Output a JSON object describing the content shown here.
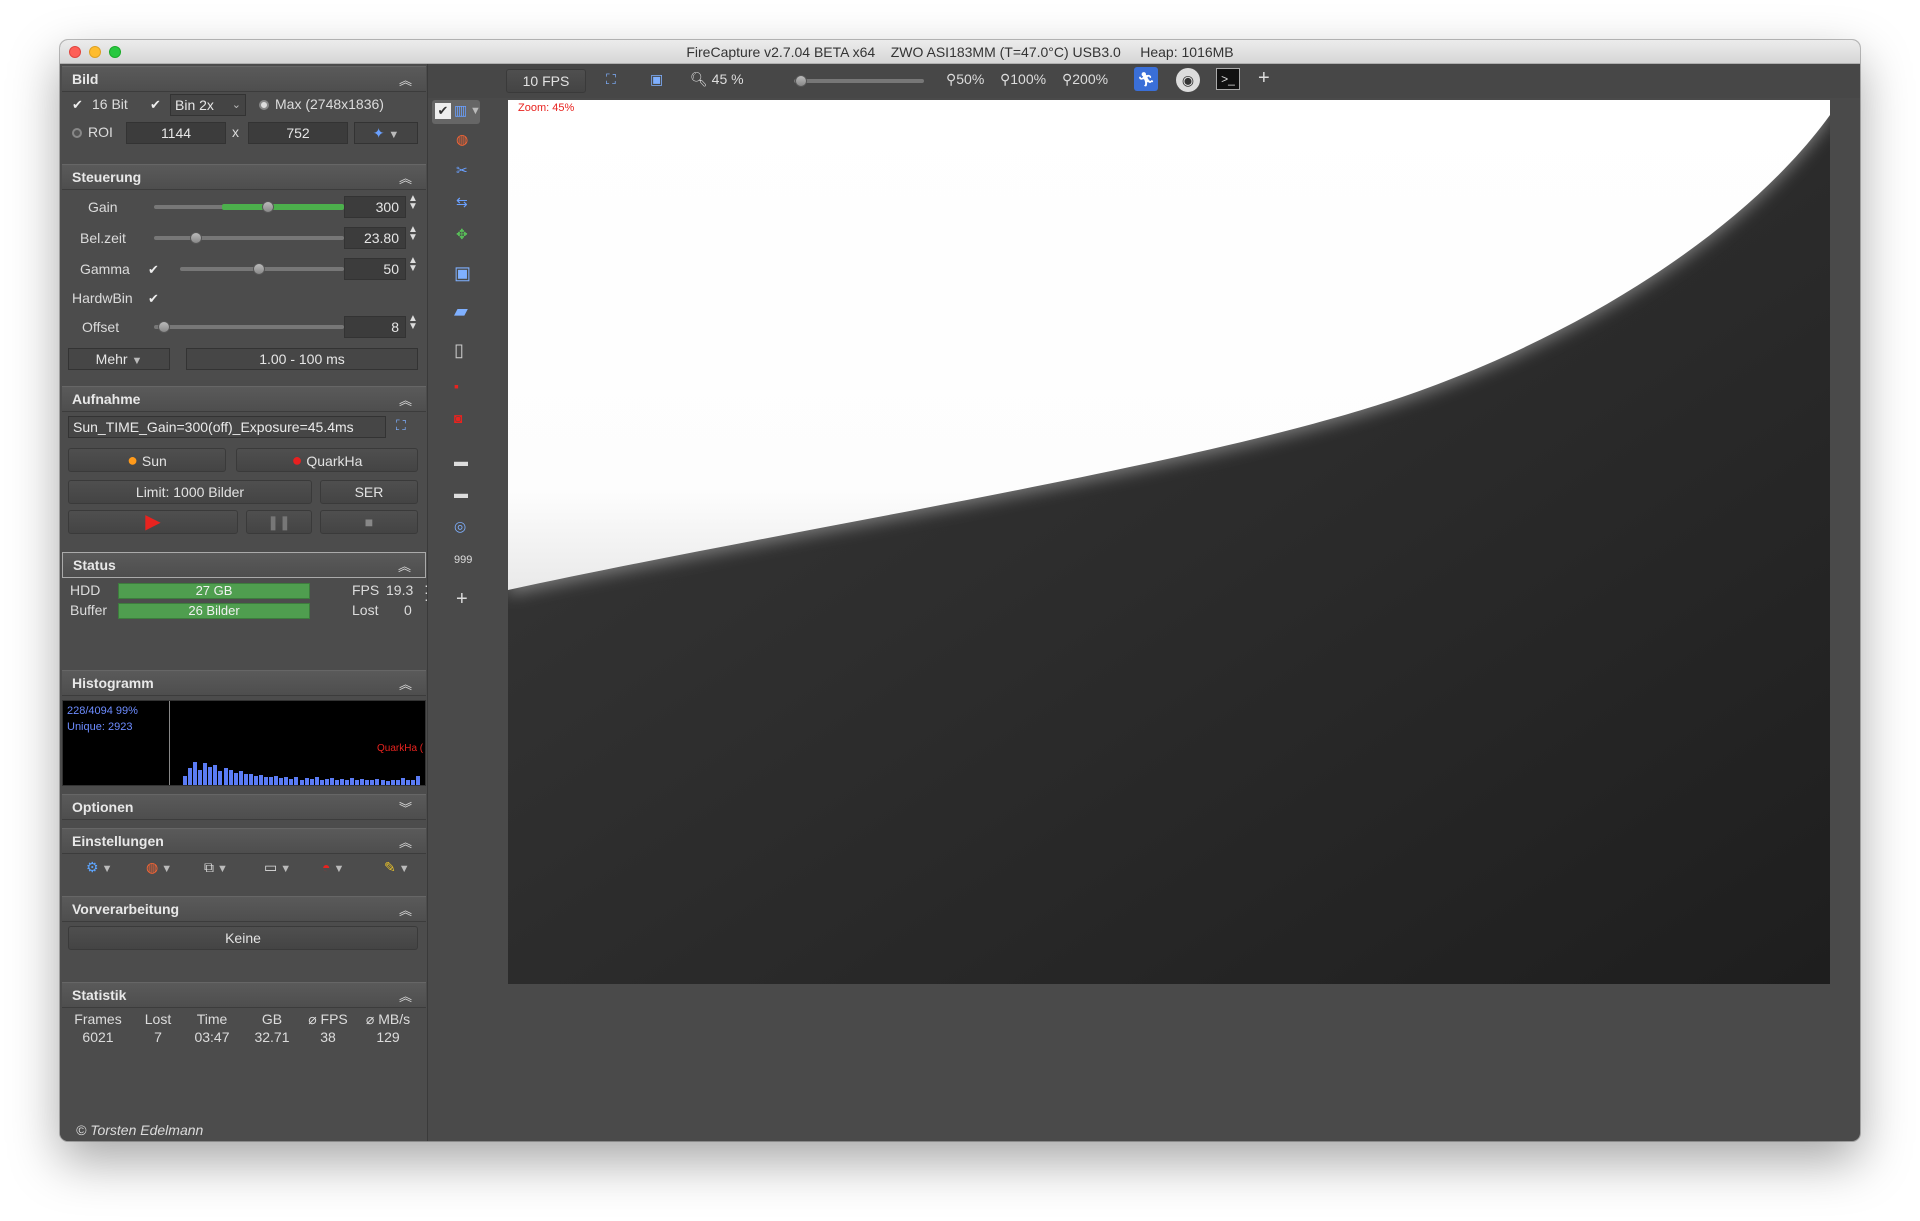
{
  "window": {
    "title": "FireCapture v2.7.04 BETA x64    ZWO ASI183MM (T=47.0°C) USB3.0     Heap: 1016MB"
  },
  "bild": {
    "header": "Bild",
    "bit_label": "16 Bit",
    "bin_value": "Bin 2x",
    "max_label": "Max (2748x1836)",
    "roi_label": "ROI",
    "roi_width": "1144",
    "roi_x": "x",
    "roi_height": "752"
  },
  "steuerung": {
    "header": "Steuerung",
    "gain_label": "Gain",
    "gain_value": "300",
    "gain_level": 0.6,
    "belzeit_label": "Bel.zeit",
    "belzeit_value": "23.80",
    "belzeit_level": 0.22,
    "gamma_label": "Gamma",
    "gamma_value": "50",
    "gamma_level": 0.48,
    "hardwbin_label": "HardwBin",
    "offset_label": "Offset",
    "offset_value": "8",
    "offset_level": 0.05,
    "mehr_label": "Mehr",
    "range_value": "1.00 - 100 ms"
  },
  "aufnahme": {
    "header": "Aufnahme",
    "filename": "Sun_TIME_Gain=300(off)_Exposure=45.4ms",
    "profile1_label": "Sun",
    "profile2_label": "QuarkHa",
    "limit_label": "Limit: 1000 Bilder",
    "format_label": "SER"
  },
  "status": {
    "header": "Status",
    "hdd_label": "HDD",
    "hdd_value": "27 GB",
    "buffer_label": "Buffer",
    "buffer_value": "26  Bilder",
    "fps_label": "FPS",
    "fps_value": "19.3",
    "lost_label": "Lost",
    "lost_value": "0"
  },
  "histogramm": {
    "header": "Histogramm",
    "line1": "228/4094 99%",
    "line2": "Unique: 2923",
    "profile_label": "QuarkHa (",
    "bars": [
      0.3,
      0.55,
      0.75,
      0.5,
      0.72,
      0.6,
      0.65,
      0.45,
      0.55,
      0.5,
      0.4,
      0.45,
      0.35,
      0.38,
      0.3,
      0.32,
      0.28,
      0.25,
      0.3,
      0.22,
      0.25,
      0.2,
      0.28,
      0.18,
      0.22,
      0.2,
      0.25,
      0.18,
      0.2,
      0.22,
      0.15,
      0.2,
      0.18,
      0.22,
      0.15,
      0.2,
      0.18,
      0.15,
      0.2,
      0.15,
      0.12,
      0.18,
      0.15,
      0.22,
      0.15,
      0.18,
      0.3
    ]
  },
  "optionen": {
    "header": "Optionen"
  },
  "einstellungen": {
    "header": "Einstellungen"
  },
  "vorverarbeitung": {
    "header": "Vorverarbeitung",
    "value": "Keine"
  },
  "statistik": {
    "header": "Statistik",
    "columns": [
      "Frames",
      "Lost",
      "Time",
      "GB",
      "⌀ FPS",
      "⌀ MB/s"
    ],
    "values": [
      "6021",
      "7",
      "03:47",
      "32.71",
      "38",
      "129"
    ]
  },
  "copyright": "© Torsten Edelmann",
  "toolbar": {
    "fps": "10 FPS",
    "zoom_value": "45 %",
    "zoom_level": 0.05,
    "z50": "50%",
    "z100": "100%",
    "z200": "200%"
  },
  "canvas": {
    "zoom_label": "Zoom: 45%"
  },
  "colors": {
    "accent_green": "#4cb04c",
    "record_red": "#e8231f",
    "hist_blue": "#5b7cf5"
  }
}
